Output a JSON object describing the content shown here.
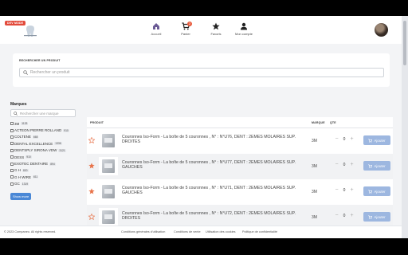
{
  "header": {
    "logo_tag": "DEV MODE",
    "nav": [
      {
        "label": "Accueil",
        "icon": "home-icon"
      },
      {
        "label": "Panier",
        "icon": "cart-icon",
        "badge": "2"
      },
      {
        "label": "Favoris",
        "icon": "star-icon"
      },
      {
        "label": "Mon compte",
        "icon": "user-icon"
      }
    ]
  },
  "search": {
    "title": "RECHERCHER UN PRODUIT",
    "placeholder": "Rechercher un produit"
  },
  "brands": {
    "title": "Marques",
    "placeholder": "Rechercher une marque",
    "items": [
      {
        "name": "3M",
        "count": "1133"
      },
      {
        "name": "ACTEON PIERRE ROLLAND",
        "count": "910"
      },
      {
        "name": "COLTENE",
        "count": "668"
      },
      {
        "name": "DENTAL EXCELLENCE",
        "count": "1336"
      },
      {
        "name": "DENTSPLY SIRONA VDW",
        "count": "3121"
      },
      {
        "name": "DESS",
        "count": "910"
      },
      {
        "name": "EXOTEC DENTAIRE",
        "count": "894"
      },
      {
        "name": "G H",
        "count": "820"
      },
      {
        "name": "G H WIRE",
        "count": "611"
      },
      {
        "name": "GC",
        "count": "1319"
      }
    ],
    "show_more": "Show more"
  },
  "table": {
    "col_product": "PRODUIT",
    "col_brand": "MARQUE",
    "col_qty": "QTE",
    "rows": [
      {
        "name": "Couronnes Iso-Form - La boîte de 5 couronnes , N° : N°U76, DENT : 2EMES MOLAIRES SUP. DROITES",
        "brand": "3M",
        "qty": "0",
        "favorite": false
      },
      {
        "name": "Couronnes Iso-Form - La boîte de 5 couronnes , N° : N°U77, DENT : 2EMES MOLAIRES SUP. GAUCHES",
        "brand": "3M",
        "qty": "0",
        "favorite": true
      },
      {
        "name": "Couronnes Iso-Form - La boîte de 5 couronnes , N° : N°U71, DENT : 2EMES MOLAIRES SUP. GAUCHES",
        "brand": "3M",
        "qty": "0",
        "favorite": true
      },
      {
        "name": "Couronnes Iso-Form - La boîte de 5 couronnes , N° : N°U72, DENT : 2EMES MOLAIRES SUP. DROITES",
        "brand": "3M",
        "qty": "0",
        "favorite": false
      }
    ],
    "add_label": "Ajouter"
  },
  "footer": {
    "copyright": "© 2023 Companeo. All rights reserved.",
    "links": [
      "Conditions générales d'utilisation",
      "Conditions de vente",
      "Utilisation des cookies",
      "Politique de confidentialité"
    ]
  },
  "colors": {
    "accent": "#4a88d6",
    "add_button": "#9db7e0",
    "favorite_star": "#e8734a",
    "badge": "#e85a3c"
  }
}
